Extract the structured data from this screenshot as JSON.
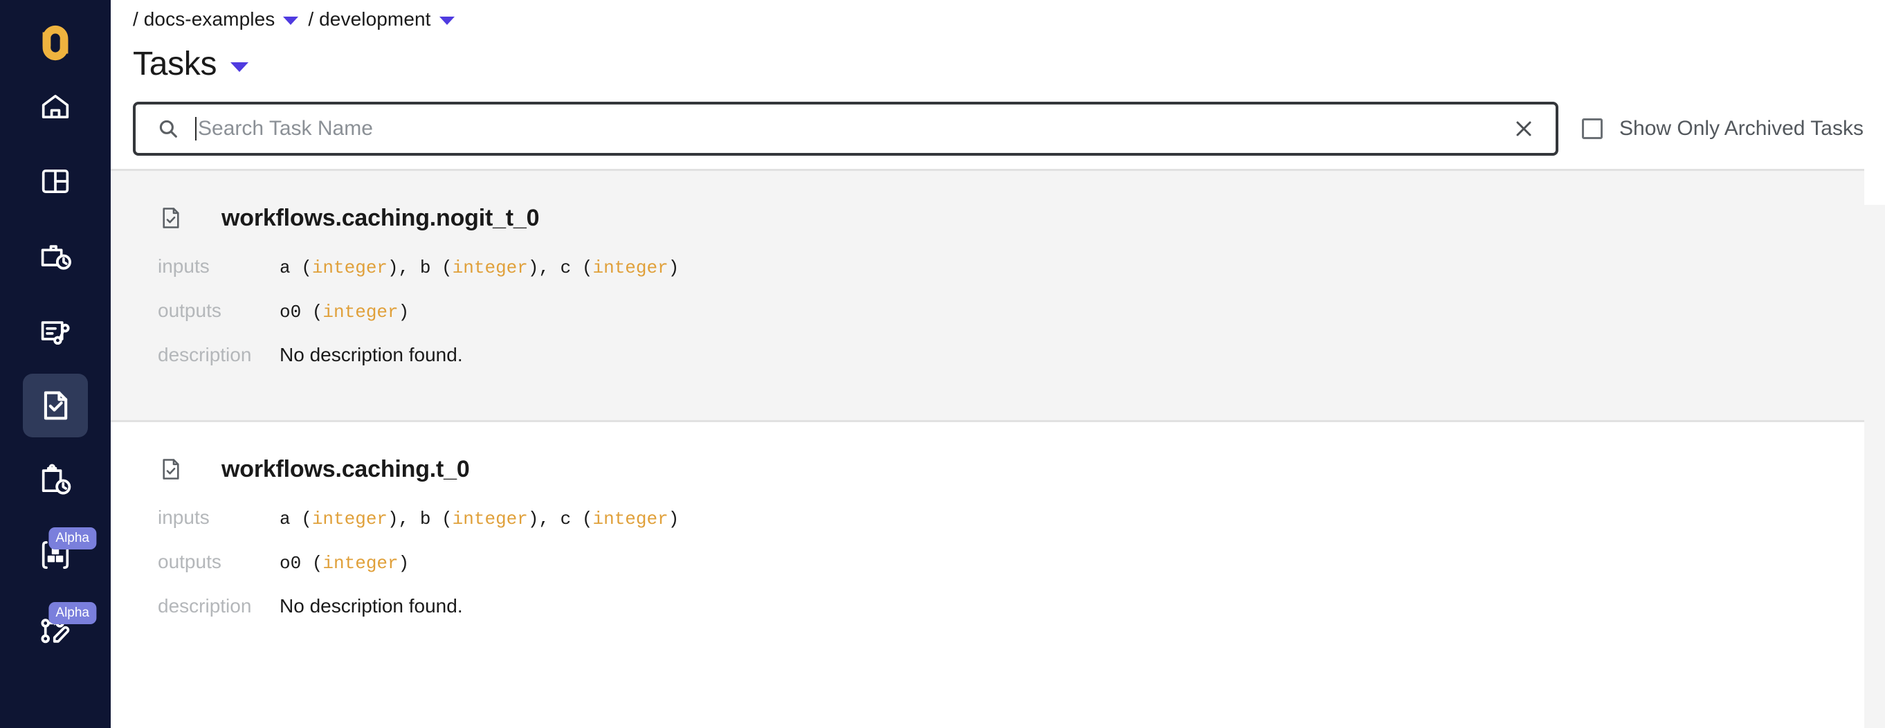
{
  "theme": {
    "sidebar_bg": "#0E1533",
    "sidebar_active_bg": "#2F3A5A",
    "logo_color": "#EFB33F",
    "accent_purple": "#4F3BE0",
    "badge_purple": "#7A7FDC",
    "type_orange": "#E0A03A",
    "card_shaded_bg": "#F4F4F4"
  },
  "sidebar": {
    "logo_name": "union-logo",
    "items": [
      {
        "icon": "home-icon",
        "name": "sidebar-item-home",
        "badge": null
      },
      {
        "icon": "dashboard-panels-icon",
        "name": "sidebar-item-dashboard",
        "badge": null
      },
      {
        "icon": "briefcase-clock-icon",
        "name": "sidebar-item-workflows",
        "badge": null
      },
      {
        "icon": "launchplan-icon",
        "name": "sidebar-item-launch-plans",
        "badge": null
      },
      {
        "icon": "document-check-icon",
        "name": "sidebar-item-tasks",
        "badge": null
      },
      {
        "icon": "clipboard-clock-icon",
        "name": "sidebar-item-executions",
        "badge": null
      },
      {
        "icon": "artifacts-cubes-icon",
        "name": "sidebar-item-artifacts",
        "badge": "Alpha"
      },
      {
        "icon": "graph-edit-icon",
        "name": "sidebar-item-graph-editor",
        "badge": "Alpha"
      }
    ]
  },
  "breadcrumb": {
    "project": "/ docs-examples",
    "domain": "/ development"
  },
  "header": {
    "title": "Tasks"
  },
  "search": {
    "placeholder": "Search Task Name",
    "value": "",
    "clear_glyph": "✕",
    "archived_label": "Show Only Archived Tasks",
    "archived_checked": false
  },
  "labels": {
    "inputs": "inputs",
    "outputs": "outputs",
    "description": "description"
  },
  "tasks": [
    {
      "name": "workflows.caching.nogit_t_0",
      "inputs": "a (integer), b (integer), c (integer)",
      "outputs": "o0 (integer)",
      "description": "No description found.",
      "inputs_parts": [
        {
          "t": "a (",
          "k": "plain"
        },
        {
          "t": "integer",
          "k": "type"
        },
        {
          "t": "), b (",
          "k": "plain"
        },
        {
          "t": "integer",
          "k": "type"
        },
        {
          "t": "), c (",
          "k": "plain"
        },
        {
          "t": "integer",
          "k": "type"
        },
        {
          "t": ")",
          "k": "plain"
        }
      ],
      "outputs_parts": [
        {
          "t": "o0 (",
          "k": "plain"
        },
        {
          "t": "integer",
          "k": "type"
        },
        {
          "t": ")",
          "k": "plain"
        }
      ],
      "shaded": true
    },
    {
      "name": "workflows.caching.t_0",
      "inputs": "a (integer), b (integer), c (integer)",
      "outputs": "o0 (integer)",
      "description": "No description found.",
      "inputs_parts": [
        {
          "t": "a (",
          "k": "plain"
        },
        {
          "t": "integer",
          "k": "type"
        },
        {
          "t": "), b (",
          "k": "plain"
        },
        {
          "t": "integer",
          "k": "type"
        },
        {
          "t": "), c (",
          "k": "plain"
        },
        {
          "t": "integer",
          "k": "type"
        },
        {
          "t": ")",
          "k": "plain"
        }
      ],
      "outputs_parts": [
        {
          "t": "o0 (",
          "k": "plain"
        },
        {
          "t": "integer",
          "k": "type"
        },
        {
          "t": ")",
          "k": "plain"
        }
      ],
      "shaded": false
    }
  ]
}
